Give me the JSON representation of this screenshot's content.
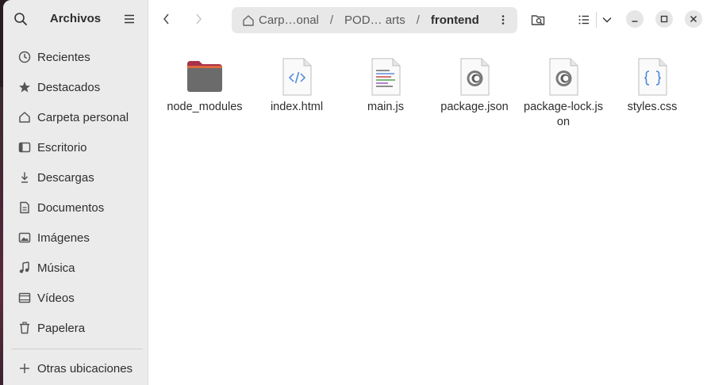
{
  "app": {
    "title": "Archivos"
  },
  "sidebar": {
    "items": [
      {
        "label": "Recientes",
        "icon": "clock-icon"
      },
      {
        "label": "Destacados",
        "icon": "star-icon"
      },
      {
        "label": "Carpeta personal",
        "icon": "home-icon"
      },
      {
        "label": "Escritorio",
        "icon": "desktop-icon"
      },
      {
        "label": "Descargas",
        "icon": "download-icon"
      },
      {
        "label": "Documentos",
        "icon": "document-icon"
      },
      {
        "label": "Imágenes",
        "icon": "image-icon"
      },
      {
        "label": "Música",
        "icon": "music-icon"
      },
      {
        "label": "Vídeos",
        "icon": "video-icon"
      },
      {
        "label": "Papelera",
        "icon": "trash-icon"
      }
    ],
    "other": {
      "label": "Otras ubicaciones",
      "icon": "plus-icon"
    }
  },
  "pathbar": {
    "segments": [
      "Carp…onal",
      "POD… arts"
    ],
    "current": "frontend"
  },
  "files": [
    {
      "name": "node_modules",
      "type": "folder"
    },
    {
      "name": "index.html",
      "type": "html"
    },
    {
      "name": "main.js",
      "type": "js"
    },
    {
      "name": "package.json",
      "type": "json"
    },
    {
      "name": "package-lock.json",
      "type": "json"
    },
    {
      "name": "styles.css",
      "type": "css"
    }
  ]
}
